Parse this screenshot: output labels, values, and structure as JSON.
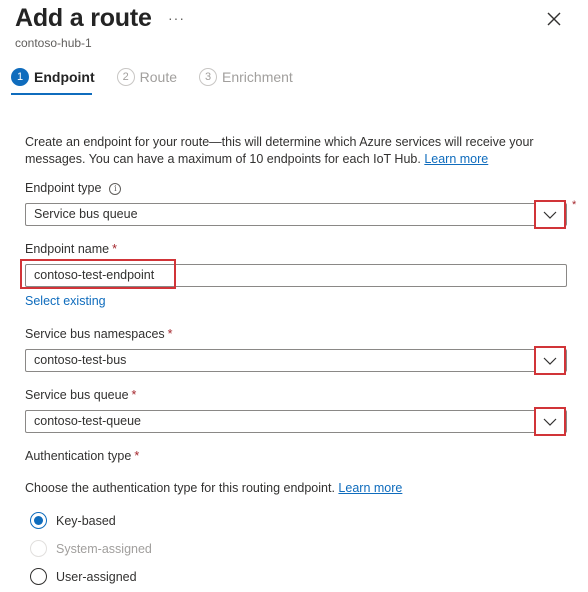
{
  "header": {
    "title": "Add a route",
    "more": "···",
    "subtitle": "contoso-hub-1",
    "close_icon": "close-icon"
  },
  "steps": [
    {
      "number": "1",
      "label": "Endpoint",
      "active": true
    },
    {
      "number": "2",
      "label": "Route",
      "active": false
    },
    {
      "number": "3",
      "label": "Enrichment",
      "active": false
    }
  ],
  "description": {
    "text": "Create an endpoint for your route—this will determine which Azure services will receive your messages. You can have a maximum of 10 endpoints for each IoT Hub.",
    "link": "Learn more"
  },
  "form": {
    "endpoint_type": {
      "label": "Endpoint type",
      "value": "Service bus queue",
      "required_mark": "*"
    },
    "endpoint_name": {
      "label": "Endpoint name",
      "required_mark": "*",
      "value": "contoso-test-endpoint"
    },
    "select_existing": "Select existing",
    "service_bus_namespaces": {
      "label": "Service bus namespaces",
      "required_mark": "*",
      "value": "contoso-test-bus"
    },
    "service_bus_queue": {
      "label": "Service bus queue",
      "required_mark": "*",
      "value": "contoso-test-queue"
    },
    "authentication_type": {
      "label": "Authentication type",
      "required_mark": "*",
      "description": "Choose the authentication type for this routing endpoint.",
      "link": "Learn more",
      "options": [
        {
          "label": "Key-based",
          "selected": true,
          "disabled": false
        },
        {
          "label": "System-assigned",
          "selected": false,
          "disabled": true
        },
        {
          "label": "User-assigned",
          "selected": false,
          "disabled": false
        }
      ]
    }
  },
  "colors": {
    "accent": "#0f6cbd",
    "highlight": "#d13438",
    "required": "#a4262c"
  }
}
